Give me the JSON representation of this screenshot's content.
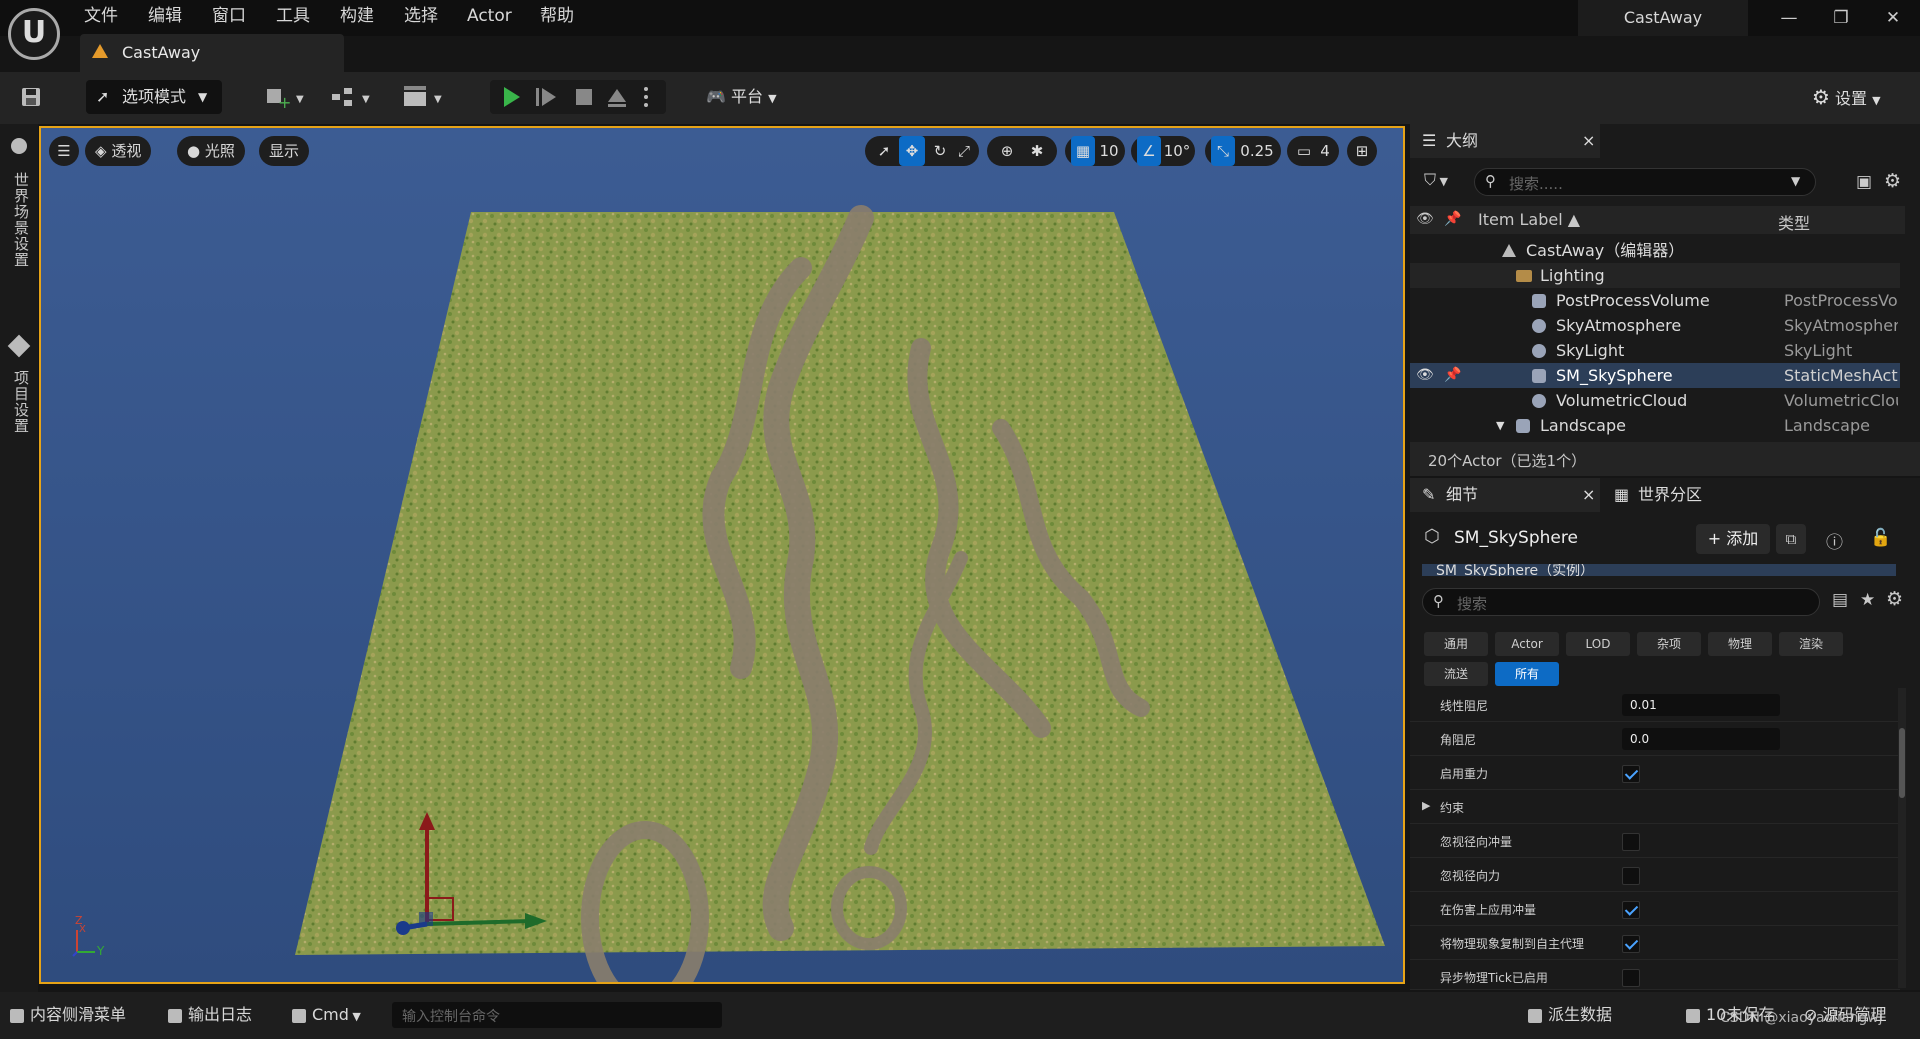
{
  "app": {
    "logo_text": "U",
    "project_title": "CastAway",
    "menu": [
      "文件",
      "编辑",
      "窗口",
      "工具",
      "构建",
      "选择",
      "Actor",
      "帮助"
    ],
    "doc_tab": "CastAway",
    "window_controls": {
      "minimize": "—",
      "restore": "❐",
      "close": "✕"
    }
  },
  "toolbar": {
    "mode_label": "选项模式",
    "platform_label": "平台",
    "settings_label": "设置"
  },
  "left_panel": {
    "world_settings": "世界场景设置",
    "project_settings": "项目设置"
  },
  "viewport": {
    "menu_icon": "☰",
    "perspective": "透视",
    "lighting": "光照",
    "show": "显示",
    "grid_snap": "10",
    "rotation_snap": "10°",
    "scale_snap": "0.25",
    "camera_speed": "4",
    "axis_labels": {
      "x": "X",
      "y": "Y",
      "z": "Z"
    }
  },
  "outliner": {
    "tab_label": "大纲",
    "close": "×",
    "search_placeholder": "搜索.....",
    "col_label": "Item Label ▲",
    "col_type": "类型",
    "rows": [
      {
        "label": "CastAway（编辑器）",
        "type": ""
      },
      {
        "label": "Lighting",
        "type": ""
      },
      {
        "label": "PostProcessVolume",
        "type": "PostProcessVolume"
      },
      {
        "label": "SkyAtmosphere",
        "type": "SkyAtmosphere"
      },
      {
        "label": "SkyLight",
        "type": "SkyLight"
      },
      {
        "label": "SM_SkySphere",
        "type": "StaticMeshActor"
      },
      {
        "label": "VolumetricCloud",
        "type": "VolumetricCloud"
      },
      {
        "label": "Landscape",
        "type": "Landscape"
      }
    ],
    "footer": "20个Actor（已选1个）"
  },
  "details": {
    "tab_label": "细节",
    "close": "×",
    "world_partition_tab": "世界分区",
    "actor_name": "SM_SkySphere",
    "add_button": "+ 添加",
    "component_row": "SM_SkySphere（实例）",
    "search_placeholder": "搜索",
    "filters": [
      "通用",
      "Actor",
      "LOD",
      "杂项",
      "物理",
      "渲染",
      "流送",
      "所有"
    ],
    "active_filter": "所有",
    "props": [
      {
        "label": "线性阻尼",
        "value": "0.01",
        "kind": "input"
      },
      {
        "label": "角阻尼",
        "value": "0.0",
        "kind": "input"
      },
      {
        "label": "启用重力",
        "checked": true,
        "kind": "check"
      },
      {
        "label": "约束",
        "kind": "section"
      },
      {
        "label": "忽视径向冲量",
        "checked": false,
        "kind": "check"
      },
      {
        "label": "忽视径向力",
        "checked": false,
        "kind": "check"
      },
      {
        "label": "在伤害上应用冲量",
        "checked": true,
        "kind": "check"
      },
      {
        "label": "将物理现象复制到自主代理",
        "checked": true,
        "kind": "check"
      },
      {
        "label": "异步物理Tick已启用",
        "checked": false,
        "kind": "check"
      }
    ]
  },
  "statusbar": {
    "content_drawer": "内容侧滑菜单",
    "output_log": "输出日志",
    "cmd": "Cmd",
    "console_placeholder": "输入控制台命令",
    "derived_data": "派生数据",
    "unsaved": "10未保存",
    "source_control": "源码管理",
    "watermark": "CSDN @xiaoyaoliangwj"
  },
  "colors": {
    "accent": "#e6a317",
    "selection": "#0d6bc5",
    "viewport_bg": "#355386"
  }
}
